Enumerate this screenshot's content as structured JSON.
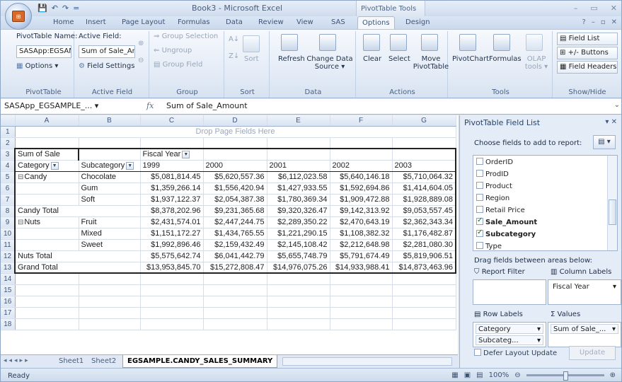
{
  "title_bar": {
    "title": "Book3 - Microsoft Excel",
    "context_title": "PivotTable Tools",
    "qat": [
      "💾",
      "↶",
      "↷",
      "="
    ]
  },
  "ribbon_tabs": [
    "Home",
    "Insert",
    "Page Layout",
    "Formulas",
    "Data",
    "Review",
    "View",
    "SAS",
    "Options",
    "Design"
  ],
  "active_tab": "Options",
  "ribbon": {
    "pivottable": {
      "name_label": "PivotTable Name:",
      "name_value": "SASApp:EGSAMF",
      "options": "Options ▾",
      "group": "PivotTable"
    },
    "active_field": {
      "label": "Active Field:",
      "value": "Sum of Sale_Amou",
      "settings": "Field Settings",
      "group": "Active Field"
    },
    "group": {
      "group_selection": "Group Selection",
      "ungroup": "Ungroup",
      "group_field": "Group Field",
      "group": "Group"
    },
    "sort": {
      "sort": "Sort",
      "group": "Sort"
    },
    "data": {
      "refresh": "Refresh",
      "change_source": "Change Data Source ▾",
      "group": "Data"
    },
    "actions": {
      "clear": "Clear",
      "select": "Select",
      "move": "Move PivotTable",
      "group": "Actions"
    },
    "tools": {
      "pivotchart": "PivotChart",
      "formulas": "Formulas",
      "olap": "OLAP tools ▾",
      "group": "Tools"
    },
    "show_hide": {
      "field_list": "Field List",
      "buttons": "+/- Buttons",
      "headers": "Field Headers",
      "group": "Show/Hide"
    }
  },
  "formula_bar": {
    "name_box": "SASApp_EGSAMPLE_... ▾",
    "fx": "fx",
    "formula": "Sum of Sale_Amount"
  },
  "columns": [
    "A",
    "B",
    "C",
    "D",
    "E",
    "F",
    "G"
  ],
  "drop_page_text": "Drop Page Fields Here",
  "pivot": {
    "sum_label": "Sum of Sale",
    "col_field": "Fiscal Year",
    "row_field_1": "Category",
    "row_field_2": "Subcategory",
    "years": [
      "1999",
      "2000",
      "2001",
      "2002",
      "2003"
    ],
    "rows": [
      {
        "n": "5",
        "a": "Candy",
        "exp": "⊟",
        "b": "Chocolate",
        "v": [
          "$5,081,814.45",
          "$5,620,557.36",
          "$6,112,023.58",
          "$5,640,146.18",
          "$5,710,064.32"
        ]
      },
      {
        "n": "6",
        "a": "",
        "exp": "",
        "b": "Gum",
        "v": [
          "$1,359,266.14",
          "$1,556,420.94",
          "$1,427,933.55",
          "$1,592,694.86",
          "$1,414,604.05"
        ]
      },
      {
        "n": "7",
        "a": "",
        "exp": "",
        "b": "Soft",
        "v": [
          "$1,937,122.37",
          "$2,054,387.38",
          "$1,780,369.34",
          "$1,909,472.88",
          "$1,928,889.08"
        ]
      },
      {
        "n": "8",
        "a": "Candy Total",
        "exp": "",
        "b": "",
        "v": [
          "$8,378,202.96",
          "$9,231,365.68",
          "$9,320,326.47",
          "$9,142,313.92",
          "$9,053,557.45"
        ]
      },
      {
        "n": "9",
        "a": "Nuts",
        "exp": "⊟",
        "b": "Fruit",
        "v": [
          "$2,431,574.01",
          "$2,447,244.75",
          "$2,289,350.22",
          "$2,470,643.19",
          "$2,362,343.34"
        ]
      },
      {
        "n": "10",
        "a": "",
        "exp": "",
        "b": "Mixed",
        "v": [
          "$1,151,172.27",
          "$1,434,765.55",
          "$1,221,290.15",
          "$1,108,382.32",
          "$1,176,482.87"
        ]
      },
      {
        "n": "11",
        "a": "",
        "exp": "",
        "b": "Sweet",
        "v": [
          "$1,992,896.46",
          "$2,159,432.49",
          "$2,145,108.42",
          "$2,212,648.98",
          "$2,281,080.30"
        ]
      },
      {
        "n": "12",
        "a": "Nuts Total",
        "exp": "",
        "b": "",
        "v": [
          "$5,575,642.74",
          "$6,041,442.79",
          "$5,655,748.79",
          "$5,791,674.49",
          "$5,819,906.51"
        ]
      },
      {
        "n": "13",
        "a": "Grand Total",
        "exp": "",
        "b": "",
        "v": [
          "$13,953,845.70",
          "$15,272,808.47",
          "$14,976,075.26",
          "$14,933,988.41",
          "$14,873,463.96"
        ]
      }
    ]
  },
  "sheet_tabs": [
    "Sheet1",
    "Sheet2",
    "EGSAMPLE.CANDY_SALES_SUMMARY"
  ],
  "active_sheet": "EGSAMPLE.CANDY_SALES_SUMMARY",
  "status": {
    "ready": "Ready",
    "zoom": "100%"
  },
  "field_pane": {
    "title": "PivotTable Field List",
    "choose": "Choose fields to add to report:",
    "fields": [
      {
        "name": "OrderID",
        "checked": false
      },
      {
        "name": "ProdID",
        "checked": false
      },
      {
        "name": "Product",
        "checked": false
      },
      {
        "name": "Region",
        "checked": false
      },
      {
        "name": "Retail Price",
        "checked": false
      },
      {
        "name": "Sale_Amount",
        "checked": true
      },
      {
        "name": "Subcategory",
        "checked": true
      },
      {
        "name": "Type",
        "checked": false
      }
    ],
    "drag_label": "Drag fields between areas below:",
    "report_filter": "Report Filter",
    "column_labels": "Column Labels",
    "column_value": "Fiscal Year",
    "row_labels": "Row Labels",
    "values": "Values",
    "row_items": [
      "Category",
      "Subcateg..."
    ],
    "value_item": "Sum of Sale_...",
    "defer": "Defer Layout Update",
    "update": "Update"
  }
}
